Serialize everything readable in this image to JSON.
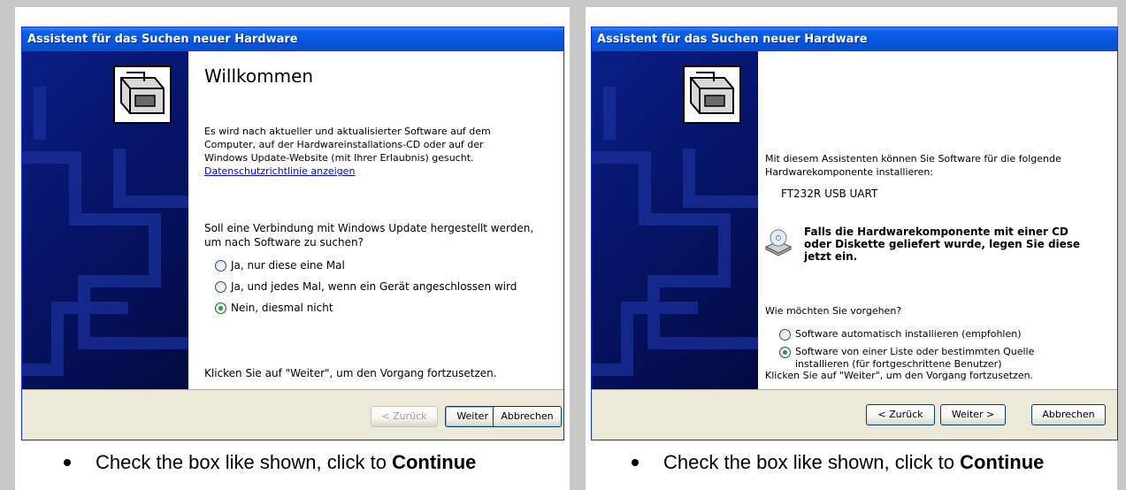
{
  "captions": [
    {
      "text": "Check the box like shown, click to ",
      "bold": "Continue"
    },
    {
      "text": "Check the box like shown, click to ",
      "bold": "Continue"
    }
  ],
  "dialog1": {
    "title": "Assistent für das Suchen neuer Hardware",
    "heading": "Willkommen",
    "intro_line1": "Es wird nach aktueller und aktualisierter Software auf dem",
    "intro_line2": "Computer, auf der Hardwareinstallations-CD oder auf der",
    "intro_line3": "Windows Update-Website (mit Ihrer Erlaubnis) gesucht.",
    "privacy_link": "Datenschutzrichtlinie anzeigen",
    "question_line1": "Soll eine Verbindung mit Windows Update hergestellt werden,",
    "question_line2": "um nach Software zu suchen?",
    "options": [
      {
        "label": "Ja, nur diese eine Mal",
        "selected": false
      },
      {
        "label": "Ja, und jedes Mal, wenn ein Gerät angeschlossen wird",
        "selected": false
      },
      {
        "label": "Nein, diesmal nicht",
        "selected": true
      }
    ],
    "continue_hint": "Klicken Sie auf \"Weiter\", um den Vorgang fortzusetzen.",
    "buttons": {
      "back": "< Zurück",
      "next": "Weiter >",
      "cancel": "Abbrechen"
    }
  },
  "dialog2": {
    "title": "Assistent für das Suchen neuer Hardware",
    "intro_line1": "Mit diesem Assistenten können Sie Software für die folgende",
    "intro_line2": "Hardwarekomponente installieren:",
    "device_name": "FT232R USB UART",
    "cd_line1": "Falls die Hardwarekomponente mit einer CD",
    "cd_line2": "oder Diskette geliefert wurde, legen Sie diese",
    "cd_line3": "jetzt ein.",
    "question": "Wie möchten Sie vorgehen?",
    "options": [
      {
        "label": "Software automatisch installieren (empfohlen)",
        "label2": "",
        "selected": false
      },
      {
        "label": "Software von einer Liste oder bestimmten Quelle",
        "label2": "installieren (für fortgeschrittene Benutzer)",
        "selected": true
      }
    ],
    "continue_hint": "Klicken Sie auf \"Weiter\", um den Vorgang fortzusetzen.",
    "buttons": {
      "back": "< Zurück",
      "next": "Weiter >",
      "cancel": "Abbrechen"
    }
  },
  "icons": {
    "wizard": "hardware-wizard-icon",
    "cd": "cd-drive-icon"
  },
  "colors": {
    "titlebar": "#0656dc",
    "sidepanel": "#061468",
    "face": "#ece9d8"
  }
}
